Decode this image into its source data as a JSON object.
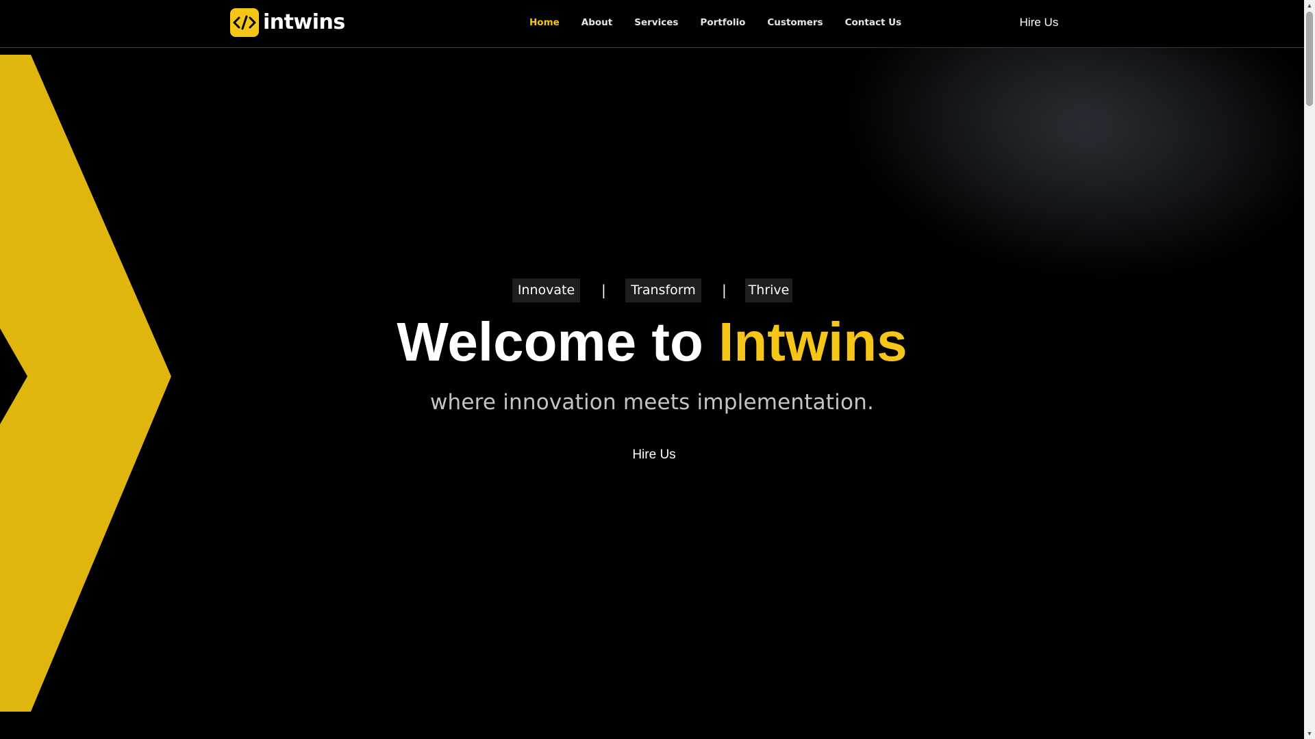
{
  "brand": {
    "name": "intwins",
    "logo_glyph": "</>",
    "accent_color": "#f5c518"
  },
  "nav": {
    "items": [
      {
        "label": "Home",
        "active": true
      },
      {
        "label": "About",
        "active": false
      },
      {
        "label": "Services",
        "active": false
      },
      {
        "label": "Portfolio",
        "active": false
      },
      {
        "label": "Customers",
        "active": false
      },
      {
        "label": "Contact Us",
        "active": false
      }
    ],
    "cta_label": "Hire Us"
  },
  "hero": {
    "taglines": [
      "Innovate",
      "Transform",
      "Thrive"
    ],
    "separator": "|",
    "title_prefix": "Welcome to ",
    "title_highlight": "Intwins",
    "subtitle": "where innovation meets implementation.",
    "cta_label": "Hire Us"
  },
  "decor": {
    "chevron_color": "#e0b60e",
    "background_color": "#000000"
  },
  "scrollbar": {
    "up_icon": "arrow-up-icon",
    "down_icon": "arrow-down-icon"
  }
}
